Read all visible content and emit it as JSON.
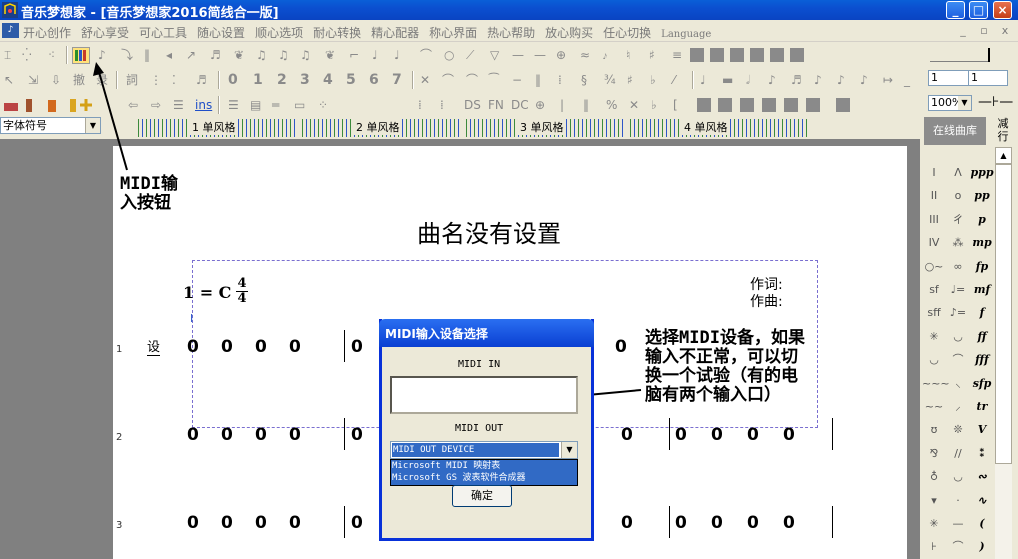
{
  "window": {
    "title": "音乐梦想家 - [音乐梦想家2016简线合一版]",
    "minimize_label": "_",
    "maximize_label": "□",
    "close_label": "×"
  },
  "menu": {
    "logo": "♪",
    "items": [
      "开心创作",
      "舒心享受",
      "可心工具",
      "随心设置",
      "顺心选项",
      "耐心转换",
      "精心配器",
      "称心界面",
      "热心帮助",
      "放心购买",
      "任心切换"
    ],
    "language": "Language",
    "mdi_buttons": [
      "_",
      "▫",
      "x"
    ]
  },
  "toolbar1": {
    "icons": [
      "select-icon",
      "note-tool-icon",
      "rest-icon",
      "midi-input-icon",
      "slur-icon",
      "tie-icon",
      "bar-icon",
      "play-icon",
      "record-icon"
    ]
  },
  "toolbar2": {
    "digits": [
      "0",
      "1",
      "2",
      "3",
      "4",
      "5",
      "6",
      "7"
    ],
    "field1_value": "1",
    "field2_value": "1"
  },
  "toolbar3": {
    "ins_label": "ins",
    "repeat_labels": [
      "DS",
      "FN",
      "DC"
    ],
    "zoom_value": "100%"
  },
  "ruler": {
    "font_select_value": "字体符号",
    "labels": [
      "1 单风格",
      "2 单风格",
      "3 单风格",
      "4 单风格"
    ]
  },
  "score": {
    "title": "曲名没有设置",
    "key_signature": "1 = C",
    "time_sig_top": "4",
    "time_sig_bottom": "4",
    "lyricist_label": "作词:",
    "composer_label": "作曲:",
    "set_mark": "设",
    "line_numbers": [
      "1",
      "2",
      "3"
    ],
    "note": "0"
  },
  "annotations": {
    "midi_button_note": "MIDI输\n入按钮",
    "midi_device_note": "选择MIDI设备，如果\n输入不正常，可以切\n换一个试验（有的电\n脑有两个输入口）"
  },
  "midi_dialog": {
    "title": "MIDI输入设备选择",
    "midi_in_label": "MIDI IN",
    "midi_out_label": "MIDI OUT",
    "midi_out_selected": "MIDI OUT DEVICE",
    "midi_out_options": [
      "Microsoft MIDI 映射表",
      "Microsoft GS 波表软件合成器"
    ],
    "ok_label": "确定"
  },
  "right_panel": {
    "online_library_label": "在线曲库",
    "collapse_label": "减行",
    "symbols": [
      "I",
      "Λ",
      "ppp",
      "II",
      "o",
      "pp",
      "III",
      "ㄔ",
      "p",
      "IV",
      "⁂",
      "mp",
      "○~",
      "∞",
      "fp",
      "sf",
      "♩=",
      "mf",
      "sff",
      "♪=",
      "f",
      "✳",
      "◡",
      "ff",
      "◡",
      "⌒",
      "fff",
      "~~~",
      "⸜",
      "sfp",
      "~~",
      "⸝",
      "tr",
      "ʊ",
      "❊",
      "V",
      "⅋",
      "//",
      "⁑",
      "♁",
      "◡",
      "∾",
      "▾",
      "·",
      "∿",
      "✳",
      "—",
      "(",
      "⊦",
      "⌒",
      ")"
    ]
  }
}
